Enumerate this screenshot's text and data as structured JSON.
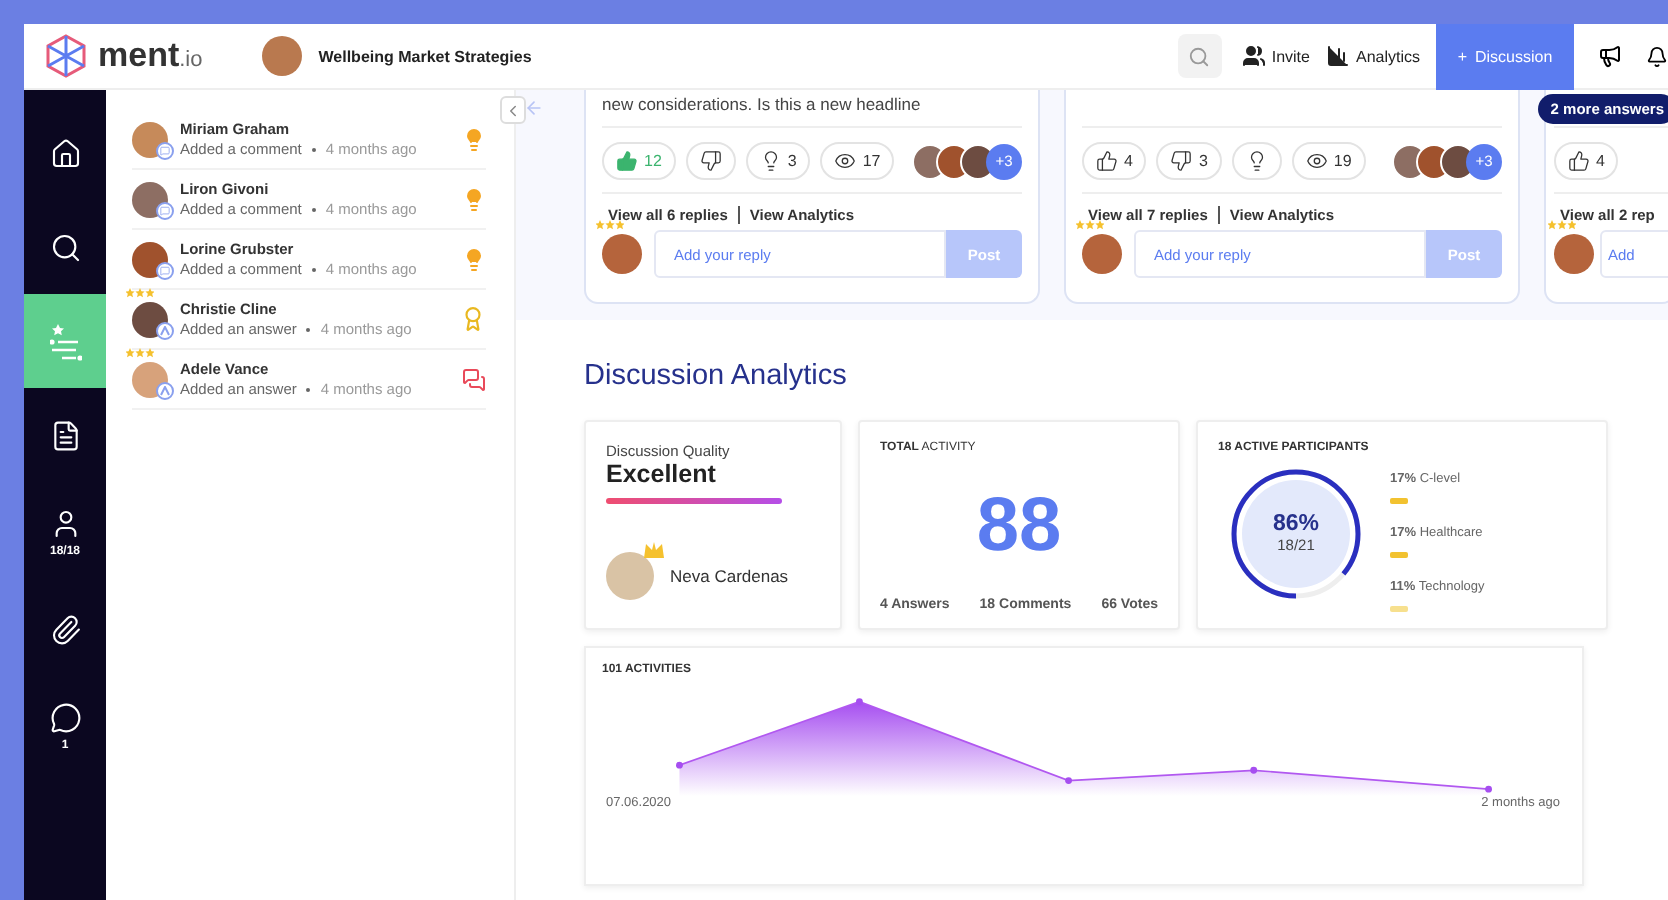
{
  "topbar": {
    "logo": "ment",
    "logo_suffix": ".io",
    "workspace": "Wellbeing Market Strategies",
    "actions": [
      {
        "kind": "invite",
        "label": "Invite"
      },
      {
        "kind": "analytics",
        "label": "Analytics"
      }
    ],
    "primary": {
      "icon": "+",
      "label": "Discussion"
    }
  },
  "nav": [
    {
      "kind": "home",
      "selected": false
    },
    {
      "kind": "question",
      "selected": false
    },
    {
      "kind": "ranking",
      "selected": true
    },
    {
      "kind": "notes",
      "selected": false
    },
    {
      "kind": "people",
      "selected": false,
      "count": "18/18"
    },
    {
      "kind": "attach",
      "selected": false
    },
    {
      "kind": "chat",
      "selected": false,
      "count": "1"
    }
  ],
  "activity": [
    {
      "name": "Miriam Graham",
      "action": "Added a comment",
      "time": "4 months ago",
      "kind": "idea",
      "starred": false
    },
    {
      "name": "Liron Givoni",
      "action": "Added a comment",
      "time": "4 months ago",
      "kind": "idea",
      "starred": false
    },
    {
      "name": "Lorine Grubster",
      "action": "Added a comment",
      "time": "4 months ago",
      "kind": "idea",
      "starred": false
    },
    {
      "name": "Christie Cline",
      "action": "Added an answer",
      "time": "4 months ago",
      "kind": "award",
      "starred": true
    },
    {
      "name": "Adele Vance",
      "action": "Added an answer",
      "time": "4 months ago",
      "kind": "debate",
      "starred": true
    }
  ],
  "answers_badge": "2 more answers",
  "cards": [
    {
      "text": "new considerations. Is this a new headline",
      "reactions": [
        {
          "kind": "like",
          "count": "12",
          "selected": true
        },
        {
          "kind": "dislike",
          "selected": false
        },
        {
          "kind": "idea",
          "count": "3",
          "selected": false
        },
        {
          "kind": "views",
          "count": "17",
          "selected": false
        }
      ],
      "more": "+3",
      "replies": "View all 6 replies",
      "analytics": "View Analytics",
      "placeholder": "Add your reply",
      "post": "Post"
    },
    {
      "reactions": [
        {
          "kind": "like",
          "count": "4",
          "selected": false
        },
        {
          "kind": "dislike",
          "count": "3",
          "selected": false
        },
        {
          "kind": "idea",
          "selected": false
        },
        {
          "kind": "views",
          "count": "19",
          "selected": false
        }
      ],
      "more": "+3",
      "replies": "View all 7 replies",
      "analytics": "View Analytics",
      "placeholder": "Add your reply",
      "post": "Post"
    },
    {
      "reactions": [
        {
          "kind": "like",
          "count": "4",
          "selected": false
        }
      ],
      "replies": "View all 2 rep",
      "placeholder": "Add"
    }
  ],
  "analytics": {
    "title": "Discussion Analytics",
    "quality": {
      "label": "Discussion Quality",
      "value": "Excellent",
      "leader": "Neva Cardenas"
    },
    "total": {
      "title_bold": "TOTAL",
      "title": "ACTIVITY",
      "value": "88",
      "stats": [
        "4 Answers",
        "18 Comments",
        "66 Votes"
      ]
    },
    "participants": {
      "title": "18 ACTIVE PARTICIPANTS",
      "percent": "86%",
      "ratio": "18/21",
      "level": 0.86,
      "groups": [
        {
          "share": "17%",
          "label": "C-level",
          "color": "#f2c230"
        },
        {
          "share": "17%",
          "label": "Healthcare",
          "color": "#f2c230"
        },
        {
          "share": "11%",
          "label": "Technology",
          "color": "#f7e08e"
        }
      ]
    },
    "activities": {
      "title": "101 ACTIVITIES",
      "start": "07.06.2020",
      "end": "2 months ago"
    }
  }
}
